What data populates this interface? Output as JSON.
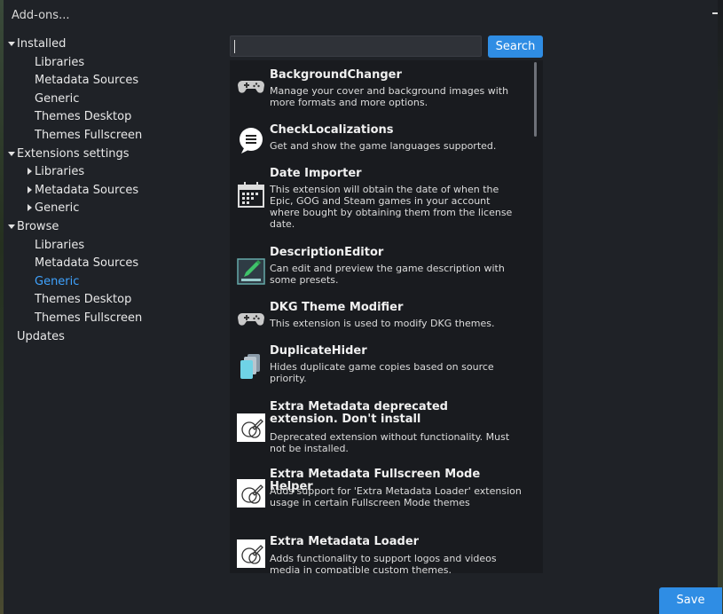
{
  "window": {
    "title": "Add-ons..."
  },
  "tree": [
    {
      "label": "Installed",
      "caret": "down",
      "indent": 0
    },
    {
      "label": "Libraries",
      "caret": "none",
      "indent": 2
    },
    {
      "label": "Metadata Sources",
      "caret": "none",
      "indent": 2
    },
    {
      "label": "Generic",
      "caret": "none",
      "indent": 2
    },
    {
      "label": "Themes Desktop",
      "caret": "none",
      "indent": 2
    },
    {
      "label": "Themes Fullscreen",
      "caret": "none",
      "indent": 2
    },
    {
      "label": "Extensions settings",
      "caret": "down",
      "indent": 0
    },
    {
      "label": "Libraries",
      "caret": "right",
      "indent": 1
    },
    {
      "label": "Metadata Sources",
      "caret": "right",
      "indent": 1
    },
    {
      "label": "Generic",
      "caret": "right",
      "indent": 1
    },
    {
      "label": "Browse",
      "caret": "down",
      "indent": 0
    },
    {
      "label": "Libraries",
      "caret": "none",
      "indent": 2
    },
    {
      "label": "Metadata Sources",
      "caret": "none",
      "indent": 2
    },
    {
      "label": "Generic",
      "caret": "none",
      "indent": 2,
      "active": true
    },
    {
      "label": "Themes Desktop",
      "caret": "none",
      "indent": 2
    },
    {
      "label": "Themes Fullscreen",
      "caret": "none",
      "indent": 2
    },
    {
      "label": "Updates",
      "caret": "none",
      "indent": 0
    }
  ],
  "search": {
    "value": "",
    "button_label": "Search"
  },
  "addons": [
    {
      "name": "BackgroundChanger",
      "desc": "Manage your cover and background images with more formats and more options.",
      "icon": "gamepad-icon"
    },
    {
      "name": "CheckLocalizations",
      "desc": "Get and show the game languages supported.",
      "icon": "speech-bubble-icon"
    },
    {
      "name": "Date Importer",
      "desc": "This extension will obtain the date of when the Epic, GOG and Steam games in your account where bought by obtaining them from the license date.",
      "icon": "calendar-icon"
    },
    {
      "name": "DescriptionEditor",
      "desc": "Can edit and preview the game description with some presets.",
      "icon": "pen-edit-icon"
    },
    {
      "name": "DKG Theme Modifier",
      "desc": "This extension is used to modify DKG themes.",
      "icon": "gamepad-icon"
    },
    {
      "name": "DuplicateHider",
      "desc": "Hides duplicate game copies based on source priority.",
      "icon": "stacked-cards-icon"
    },
    {
      "name": "Extra Metadata deprecated extension. Don't install",
      "desc": "Deprecated extension without functionality. Must not be installed.",
      "icon": "extra-metadata-icon"
    },
    {
      "name": "Extra Metadata Fullscreen Mode Helper",
      "desc": "Adds support for 'Extra Metadata Loader' extension usage in certain Fullscreen Mode themes",
      "icon": "extra-metadata-icon"
    },
    {
      "name": "Extra Metadata Loader",
      "desc": "Adds functionality to support logos and videos media in compatible custom themes.",
      "icon": "extra-metadata-icon"
    }
  ],
  "footer": {
    "save_label": "Save"
  }
}
